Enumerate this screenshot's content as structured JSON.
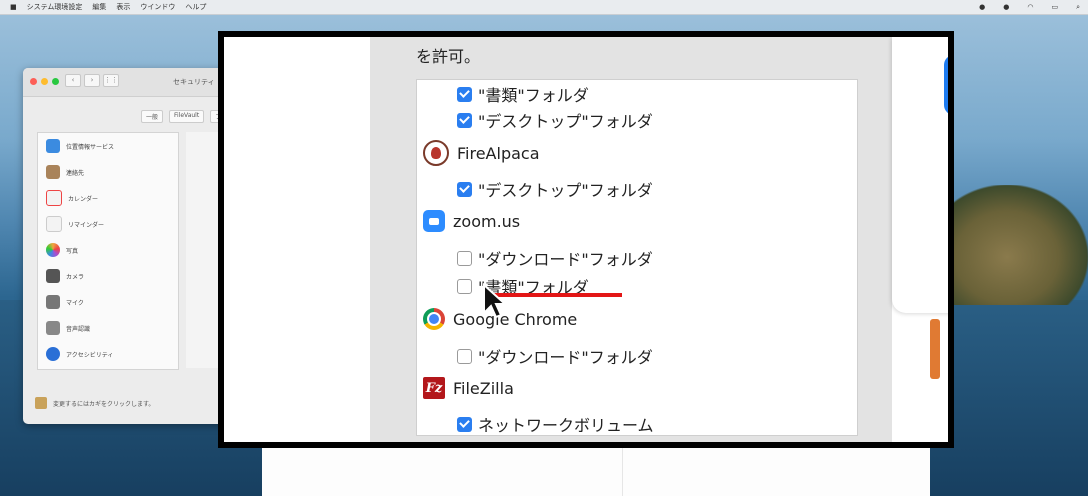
{
  "menubar": {
    "apple": "",
    "items": [
      "システム環境設定",
      "編集",
      "表示",
      "ウインドウ",
      "ヘルプ"
    ]
  },
  "prefs_window": {
    "title": "セキュリティ",
    "tabs": [
      "一般",
      "FileVault",
      "ファ"
    ],
    "sidebar": [
      {
        "label": "位置情報サービス",
        "color": "#3b8be0"
      },
      {
        "label": "連絡先",
        "color": "#a9835a"
      },
      {
        "label": "カレンダー",
        "color": "#e44"
      },
      {
        "label": "リマインダー",
        "color": "#ddd"
      },
      {
        "label": "写真",
        "color": "#f0a640"
      },
      {
        "label": "カメラ",
        "color": "#555"
      },
      {
        "label": "マイク",
        "color": "#777"
      },
      {
        "label": "音声認識",
        "color": "#888"
      },
      {
        "label": "アクセシビリティ",
        "color": "#2a6fd6"
      }
    ],
    "lock_text": "変更するにはカギをクリックします。"
  },
  "zoom_panel": {
    "allow_text": "を許可。",
    "entries": [
      {
        "kind": "folder",
        "label": "\"書類\"フォルダ",
        "checked": true
      },
      {
        "kind": "folder",
        "label": "\"デスクトップ\"フォルダ",
        "checked": true
      },
      {
        "kind": "app",
        "label": "FireAlpaca",
        "icon": "firealpaca-icon"
      },
      {
        "kind": "folder",
        "label": "\"デスクトップ\"フォルダ",
        "checked": true
      },
      {
        "kind": "app",
        "label": "zoom.us",
        "icon": "zoom-icon"
      },
      {
        "kind": "folder",
        "label": "\"ダウンロード\"フォルダ",
        "checked": false
      },
      {
        "kind": "folder",
        "label": "\"書類\"フォルダ",
        "checked": false
      },
      {
        "kind": "app",
        "label": "Google Chrome",
        "icon": "chrome-icon"
      },
      {
        "kind": "folder",
        "label": "\"ダウンロード\"フォルダ",
        "checked": false
      },
      {
        "kind": "app",
        "label": "FileZilla",
        "icon": "filezilla-icon"
      },
      {
        "kind": "folder",
        "label": "ネットワークボリューム",
        "checked": true
      }
    ],
    "accent": "#2a7ef0",
    "highlight_color": "#e31616"
  }
}
